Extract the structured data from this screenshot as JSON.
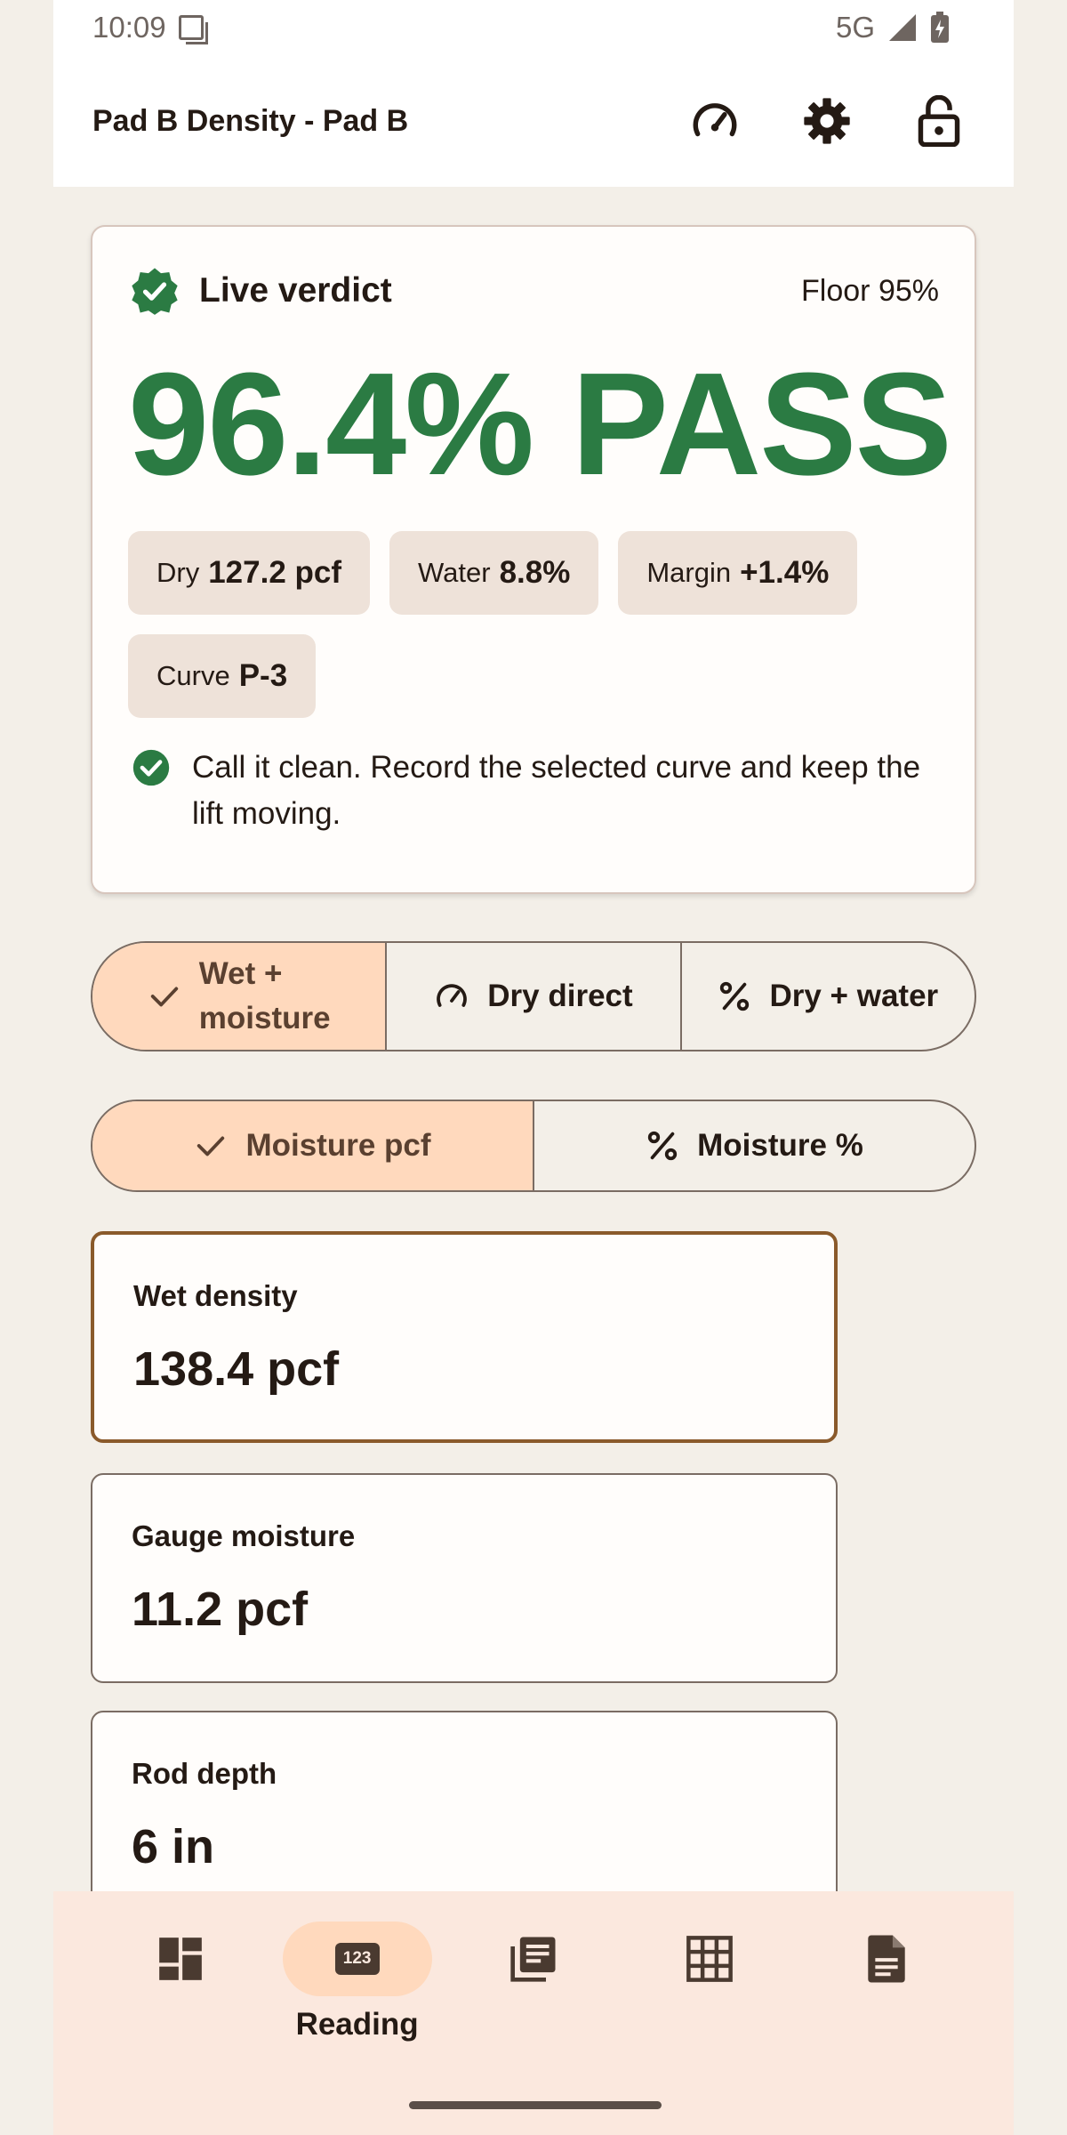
{
  "status_bar": {
    "time": "10:09",
    "network": "5G"
  },
  "header": {
    "title": "Pad B Density - Pad B"
  },
  "verdict": {
    "label": "Live verdict",
    "floor": "Floor 95%",
    "result": "96.4% PASS",
    "chips": [
      {
        "label": "Dry",
        "value": "127.2 pcf"
      },
      {
        "label": "Water",
        "value": "8.8%"
      },
      {
        "label": "Margin",
        "value": "+1.4%"
      },
      {
        "label": "Curve",
        "value": "P-3"
      }
    ],
    "note": "Call it clean. Record the selected curve and keep the lift moving."
  },
  "mode_toggle": {
    "options": [
      {
        "label_line1": "Wet +",
        "label_line2": "moisture",
        "selected": true
      },
      {
        "label": "Dry direct"
      },
      {
        "label": "Dry + water"
      }
    ]
  },
  "moisture_toggle": {
    "options": [
      {
        "label": "Moisture pcf",
        "selected": true
      },
      {
        "label": "Moisture %"
      }
    ]
  },
  "fields": [
    {
      "label": "Wet density",
      "value": "138.4 pcf",
      "focused": true
    },
    {
      "label": "Gauge moisture",
      "value": "11.2 pcf"
    },
    {
      "label": "Rod depth",
      "value": "6 in"
    }
  ],
  "bottom_nav": {
    "items": [
      {
        "icon": "dashboard-icon"
      },
      {
        "icon": "numeric-keypad-icon",
        "label": "Reading",
        "badge": "123",
        "active": true
      },
      {
        "icon": "library-books-icon"
      },
      {
        "icon": "grid-icon"
      },
      {
        "icon": "document-icon"
      }
    ]
  },
  "colors": {
    "pass_green": "#2b7b43",
    "accent_peach": "#ffd9bd",
    "nav_bg": "#fbe8de"
  }
}
